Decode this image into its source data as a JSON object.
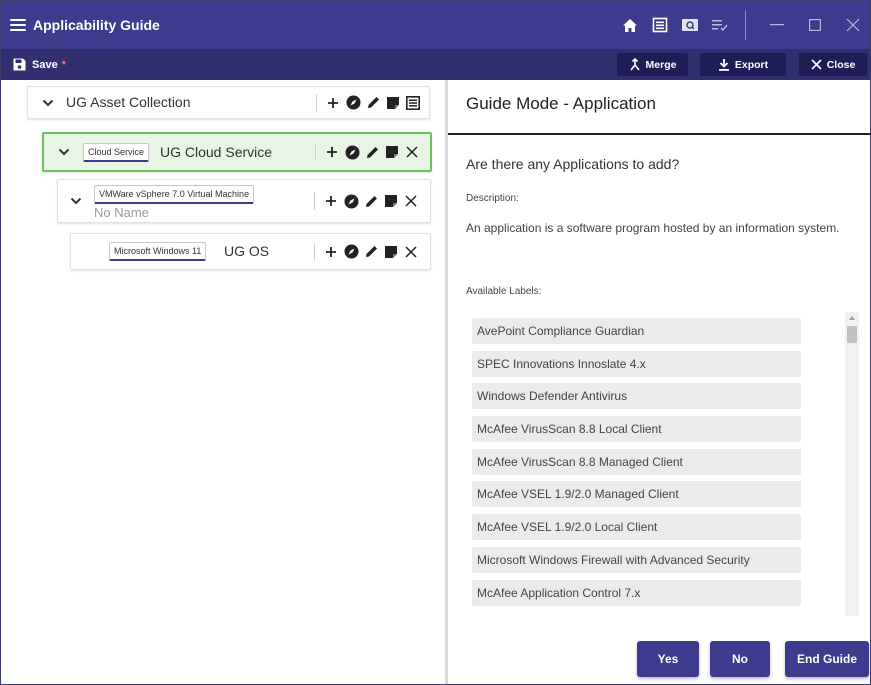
{
  "app": {
    "title": "Applicability Guide"
  },
  "toolbar": {
    "save_label": "Save",
    "unsaved_marker": "*",
    "merge_label": "Merge",
    "export_label": "Export",
    "close_label": "Close"
  },
  "tree": {
    "root": {
      "title": "UG Asset Collection"
    },
    "cloud": {
      "tag": "Cloud Service",
      "title": "UG Cloud Service"
    },
    "vm": {
      "tag": "VMWare vSphere 7.0 Virtual Machine",
      "name_placeholder": "No Name"
    },
    "os": {
      "tag": "Microsoft Windows 11",
      "title": "UG OS"
    }
  },
  "guide": {
    "heading": "Guide Mode - Application",
    "question": "Are there any Applications to add?",
    "description_label": "Description:",
    "description": "An application is a software program hosted by an information system.",
    "labels_heading": "Available Labels:",
    "labels": [
      "AvePoint Compliance Guardian",
      "SPEC Innovations Innoslate 4.x",
      "Windows Defender Antivirus",
      "McAfee VirusScan 8.8 Local Client",
      "McAfee VirusScan 8.8 Managed Client",
      "McAfee VSEL 1.9/2.0 Managed Client",
      "McAfee VSEL 1.9/2.0 Local Client",
      "Microsoft Windows Firewall with Advanced Security",
      "McAfee Application Control 7.x"
    ],
    "yes_label": "Yes",
    "no_label": "No",
    "end_label": "End Guide"
  },
  "colors": {
    "titlebar": "#3d3b8e",
    "toolbar": "#312f70",
    "selected_node_bg": "#e8f5e4",
    "selected_node_border": "#6bc25c"
  }
}
